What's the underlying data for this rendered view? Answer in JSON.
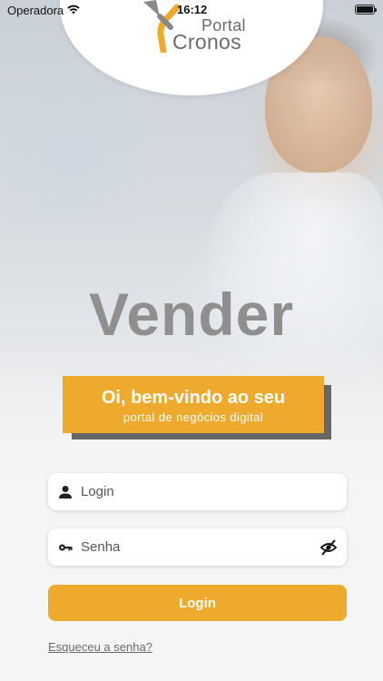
{
  "status_bar": {
    "carrier": "Operadora",
    "time": "16:12"
  },
  "logo": {
    "line1": "Portal",
    "line2": "Cronos"
  },
  "hero": {
    "word": "Vender"
  },
  "banner": {
    "title": "Oi, bem-vindo ao seu",
    "subtitle": "portal de negócios digital"
  },
  "form": {
    "login_placeholder": "Login",
    "password_placeholder": "Senha",
    "submit_label": "Login",
    "forgot_label": "Esqueceu a senha?"
  },
  "colors": {
    "accent": "#eeaa2c",
    "banner_shadow": "#666666",
    "logo_text": "#6b6b6b"
  },
  "icons": {
    "status_wifi": "wifi-icon",
    "status_battery": "battery-icon",
    "login_field": "user-icon",
    "password_field": "key-icon",
    "password_toggle": "eye-slash-icon"
  }
}
